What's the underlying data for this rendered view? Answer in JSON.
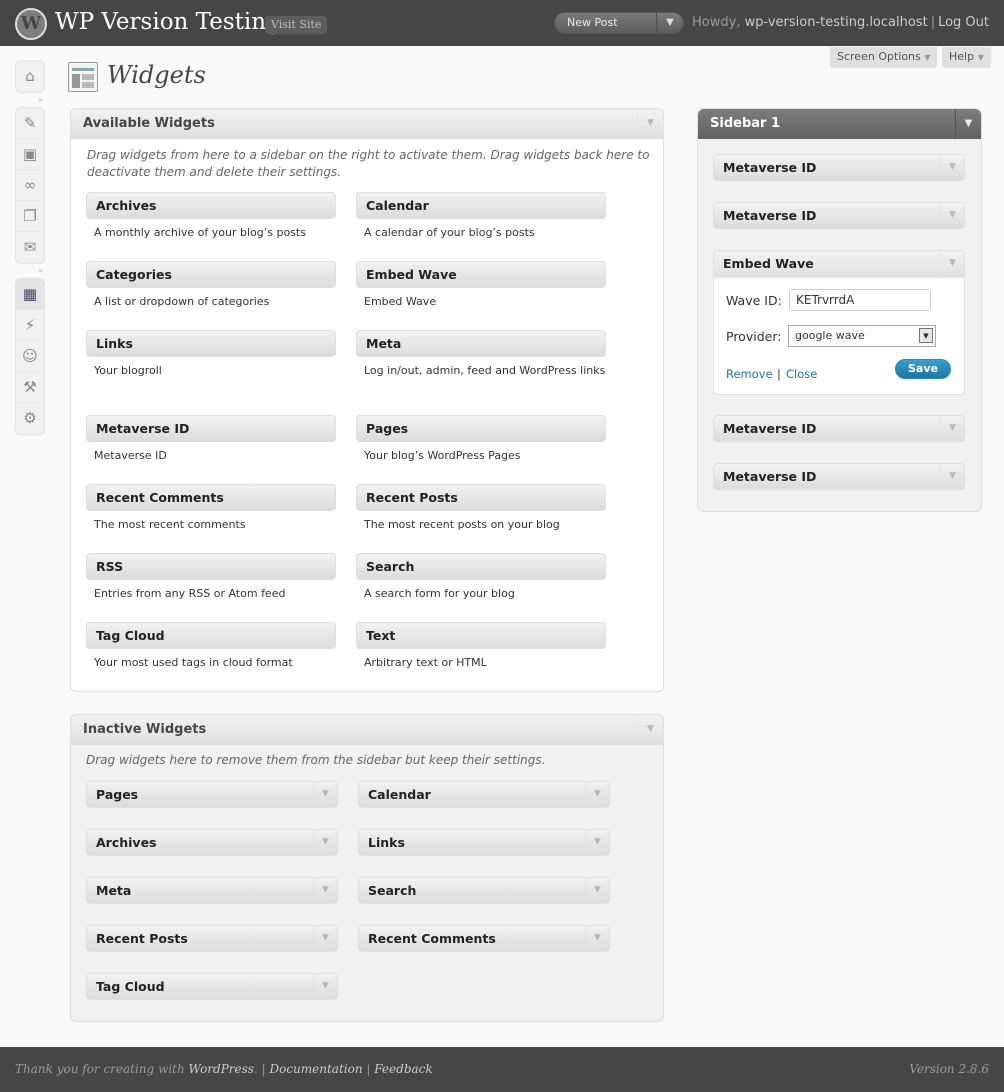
{
  "header": {
    "logo_glyph": "W",
    "site_title": "WP Version Testing",
    "visit_site": "Visit Site",
    "favorite_action": "New Post",
    "howdy": "Howdy, ",
    "username": "wp-version-testing.localhost",
    "separator": "|",
    "logout": "Log Out"
  },
  "meta_tabs": {
    "screen_options": "Screen Options",
    "help": "Help"
  },
  "admin_menu": {
    "group1": [
      "dashboard-icon"
    ],
    "group2": [
      "posts-icon",
      "media-icon",
      "links-icon",
      "pages-icon",
      "comments-icon"
    ],
    "group3": [
      "appearance-icon",
      "plugins-icon",
      "users-icon",
      "tools-icon",
      "settings-icon"
    ]
  },
  "page": {
    "title": "Widgets"
  },
  "available": {
    "title": "Available Widgets",
    "description": "Drag widgets from here to a sidebar on the right to activate them. Drag widgets back here to deactivate them and delete their settings.",
    "widgets": [
      {
        "name": "Archives",
        "desc": "A monthly archive of your blog’s posts"
      },
      {
        "name": "Calendar",
        "desc": "A calendar of your blog’s posts"
      },
      {
        "name": "Categories",
        "desc": "A list or dropdown of categories"
      },
      {
        "name": "Embed Wave",
        "desc": "Embed Wave"
      },
      {
        "name": "Links",
        "desc": "Your blogroll"
      },
      {
        "name": "Meta",
        "desc": "Log in/out, admin, feed and WordPress links"
      },
      {
        "name": "Metaverse ID",
        "desc": "Metaverse ID"
      },
      {
        "name": "Pages",
        "desc": "Your blog’s WordPress Pages"
      },
      {
        "name": "Recent Comments",
        "desc": "The most recent comments"
      },
      {
        "name": "Recent Posts",
        "desc": "The most recent posts on your blog"
      },
      {
        "name": "RSS",
        "desc": "Entries from any RSS or Atom feed"
      },
      {
        "name": "Search",
        "desc": "A search form for your blog"
      },
      {
        "name": "Tag Cloud",
        "desc": "Your most used tags in cloud format"
      },
      {
        "name": "Text",
        "desc": "Arbitrary text or HTML"
      }
    ]
  },
  "inactive": {
    "title": "Inactive Widgets",
    "description": "Drag widgets here to remove them from the sidebar but keep their settings.",
    "widgets": [
      "Pages",
      "Calendar",
      "Archives",
      "Links",
      "Meta",
      "Search",
      "Recent Posts",
      "Recent Comments",
      "Tag Cloud"
    ]
  },
  "sidebar": {
    "title": "Sidebar 1",
    "widgets": [
      "Metaverse ID",
      "Metaverse ID",
      "Embed Wave",
      "Metaverse ID",
      "Metaverse ID"
    ],
    "embed_form": {
      "wave_id_label": "Wave ID:",
      "wave_id_value": "KETrvrrdA",
      "provider_label": "Provider:",
      "provider_value": "google wave",
      "remove": "Remove",
      "separator": "|",
      "close": "Close",
      "save": "Save"
    }
  },
  "footer": {
    "thanks_prefix": "Thank you for creating with ",
    "wordpress": "WordPress",
    "period": ".",
    "separator": "|",
    "documentation": "Documentation",
    "feedback": "Feedback",
    "version": "Version 2.8.6"
  },
  "icons": {
    "toggle_arrow": "▼",
    "menu_sep": "»",
    "dashboard-icon": "⌂",
    "posts-icon": "✎",
    "media-icon": "▣",
    "links-icon": "∞",
    "pages-icon": "❐",
    "comments-icon": "✉",
    "appearance-icon": "▦",
    "plugins-icon": "⚡",
    "users-icon": "☺",
    "tools-icon": "⚒",
    "settings-icon": "⚙"
  },
  "colors": {
    "header_bg": "#464646",
    "link": "#21759b",
    "save_button": "#21759b",
    "sidebar_header": "#6d6d6d"
  }
}
